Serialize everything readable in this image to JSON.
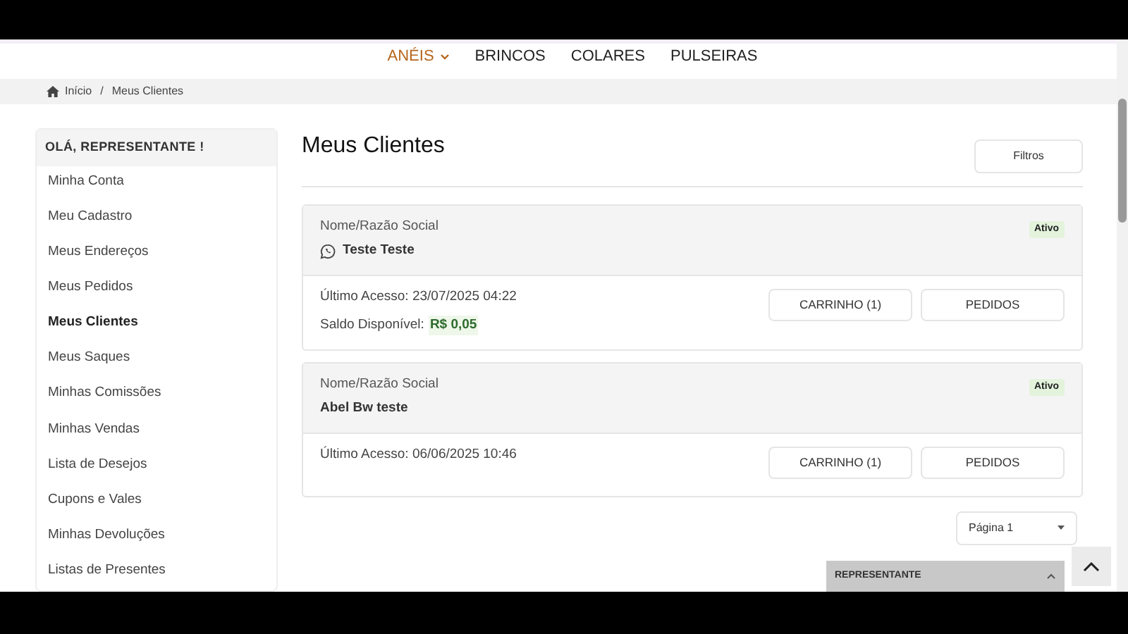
{
  "nav": [
    {
      "label": "ANÉIS",
      "selected": true,
      "dropdown": true
    },
    {
      "label": "BRINCOS",
      "selected": false,
      "dropdown": false
    },
    {
      "label": "COLARES",
      "selected": false,
      "dropdown": false
    },
    {
      "label": "PULSEIRAS",
      "selected": false,
      "dropdown": false
    }
  ],
  "breadcrumb": [
    "Início",
    "Meus Clientes"
  ],
  "breadcrumb_separator": "/",
  "sidebar": {
    "title": "OLÁ, REPRESENTANTE !",
    "items": [
      {
        "label": "Minha Conta",
        "selected": false
      },
      {
        "label": "Meu Cadastro",
        "selected": false
      },
      {
        "label": "Meus Endereços",
        "selected": false
      },
      {
        "label": "Meus Pedidos",
        "selected": false
      },
      {
        "label": "Meus Clientes",
        "selected": true
      },
      {
        "label": "Meus Saques",
        "selected": false
      },
      {
        "label": "Minhas Comissões",
        "selected": false
      },
      {
        "label": "Minhas Vendas",
        "selected": false
      },
      {
        "label": "Lista de Desejos",
        "selected": false
      },
      {
        "label": "Cupons e Vales",
        "selected": false
      },
      {
        "label": "Minhas Devoluções",
        "selected": false
      },
      {
        "label": "Listas de Presentes",
        "selected": false
      }
    ]
  },
  "page_title": "Meus Clientes",
  "filter_button": "Filtros",
  "clients": [
    {
      "name_label": "Nome/Razão Social",
      "name": "Teste Teste",
      "whatsapp": true,
      "status": "Ativo",
      "last_access": "Último Acesso: 23/07/2025 04:22",
      "balance_label": "Saldo Disponível:",
      "balance": "R$ 0,05",
      "buttons": [
        "CARRINHO (1)",
        "PEDIDOS"
      ]
    },
    {
      "name_label": "Nome/Razão Social",
      "name": "Abel Bw teste",
      "whatsapp": false,
      "status": "Ativo",
      "last_access": "Último Acesso: 06/06/2025 10:46",
      "buttons": [
        "CARRINHO (1)",
        "PEDIDOS"
      ]
    }
  ],
  "pagination": "Página 1",
  "rep_panel": {
    "title": "REPRESENTANTE",
    "expanded": false
  }
}
